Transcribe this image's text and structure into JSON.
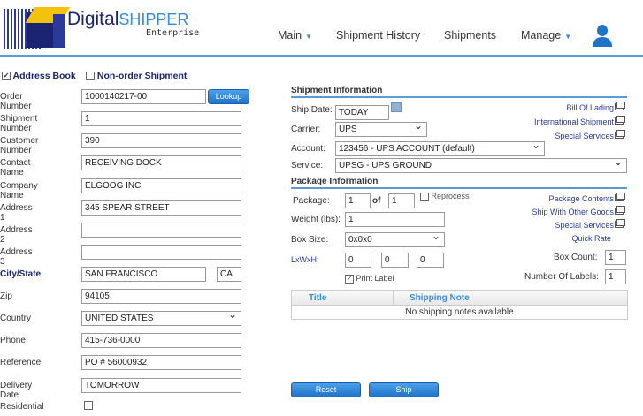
{
  "header": {
    "logo_main": "Digital",
    "logo_accent": "SHIPPER",
    "logo_sub": "Enterprise",
    "nav": [
      {
        "label": "Main",
        "dropdown": true
      },
      {
        "label": "Shipment History"
      },
      {
        "label": "Shipments"
      },
      {
        "label": "Manage",
        "dropdown": true
      }
    ]
  },
  "left": {
    "address_book": "Address Book",
    "non_order": "Non-order Shipment",
    "lookup": "Lookup",
    "fields": [
      {
        "label": "Order Number",
        "value": "1000140217-00"
      },
      {
        "label": "Shipment Number",
        "value": "1"
      },
      {
        "label": "Customer Number",
        "value": "390"
      },
      {
        "label": "Contact Name",
        "value": "RECEIVING DOCK"
      },
      {
        "label": "Company Name",
        "value": "ELGOOG INC"
      },
      {
        "label": "Address 1",
        "value": "345 SPEAR STREET"
      },
      {
        "label": "Address 2",
        "value": ""
      },
      {
        "label": "Address 3",
        "value": ""
      },
      {
        "label": "City/State",
        "value": "SAN FRANCISCO",
        "state": "CA"
      },
      {
        "label": "Zip",
        "value": "94105"
      },
      {
        "label": "Country",
        "value": "UNITED STATES"
      },
      {
        "label": "Phone",
        "value": "415-736-0000"
      },
      {
        "label": "Reference",
        "value": "PO # 56000932"
      },
      {
        "label": "Delivery Date",
        "value": "TOMORROW"
      },
      {
        "label": "Residential",
        "value": ""
      }
    ]
  },
  "shipment": {
    "title": "Shipment Information",
    "ship_date_label": "Ship Date:",
    "ship_date": "TODAY",
    "carrier_label": "Carrier:",
    "carrier": "UPS",
    "account_label": "Account:",
    "account": "123456 - UPS ACCOUNT (default)",
    "service_label": "Service:",
    "service": "UPSG - UPS GROUND",
    "links": [
      "Bill Of Lading",
      "International Shipment",
      "Special Services"
    ]
  },
  "package": {
    "title": "Package Information",
    "package_label": "Package:",
    "package": "1",
    "of": "of",
    "of_value": "1",
    "reprocess": "Reprocess",
    "weight_label": "Weight (lbs):",
    "weight": "1",
    "box_size_label": "Box Size:",
    "box_size": "0x0x0",
    "lwh_label": "LxWxH:",
    "l": "0",
    "w": "0",
    "h": "0",
    "print_label": "Print Label",
    "box_count_label": "Box Count:",
    "box_count": "1",
    "labels_label": "Number Of Labels:",
    "labels": "1",
    "links": [
      "Package Contents",
      "Ship With Other Goods",
      "Special Services"
    ],
    "quick_rate": "Quick Rate"
  },
  "notes": {
    "col_title": "Title",
    "col_note": "Shipping Note",
    "empty": "No shipping notes available"
  },
  "actions": {
    "reset": "Reset",
    "ship": "Ship"
  }
}
